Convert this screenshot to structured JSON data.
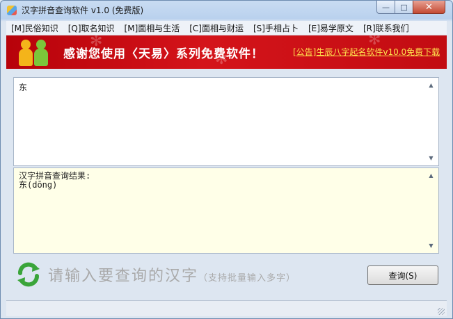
{
  "window": {
    "title": "汉字拼音查询软件 v1.0 (免费版)",
    "controls": {
      "minimize": "—",
      "maximize": "□",
      "close": "✕"
    }
  },
  "menu": [
    "[M]民俗知识",
    "[Q]取名知识",
    "[M]面相与生活",
    "[C]面相与财运",
    "[S]手相占卜",
    "[E]易学原文",
    "[R]联系我们"
  ],
  "banner": {
    "slogan": "感谢您使用〈天易〉系列免费软件！",
    "announcement_link": "[公告]生辰八字起名软件v10.0免费下载",
    "colors": {
      "background": "#c90d13",
      "slogan": "#ffffff",
      "link": "#ffe14d"
    }
  },
  "input": {
    "text": "东"
  },
  "result": {
    "heading": "汉字拼音查询结果:",
    "line": "东(dōng)"
  },
  "bottom": {
    "hint_main": "请输入要查询的汉字",
    "hint_sub": "（支持批量输入多字）",
    "query_button": "查询(S)"
  },
  "scrollbars": {
    "up": "▲",
    "down": "▼"
  }
}
